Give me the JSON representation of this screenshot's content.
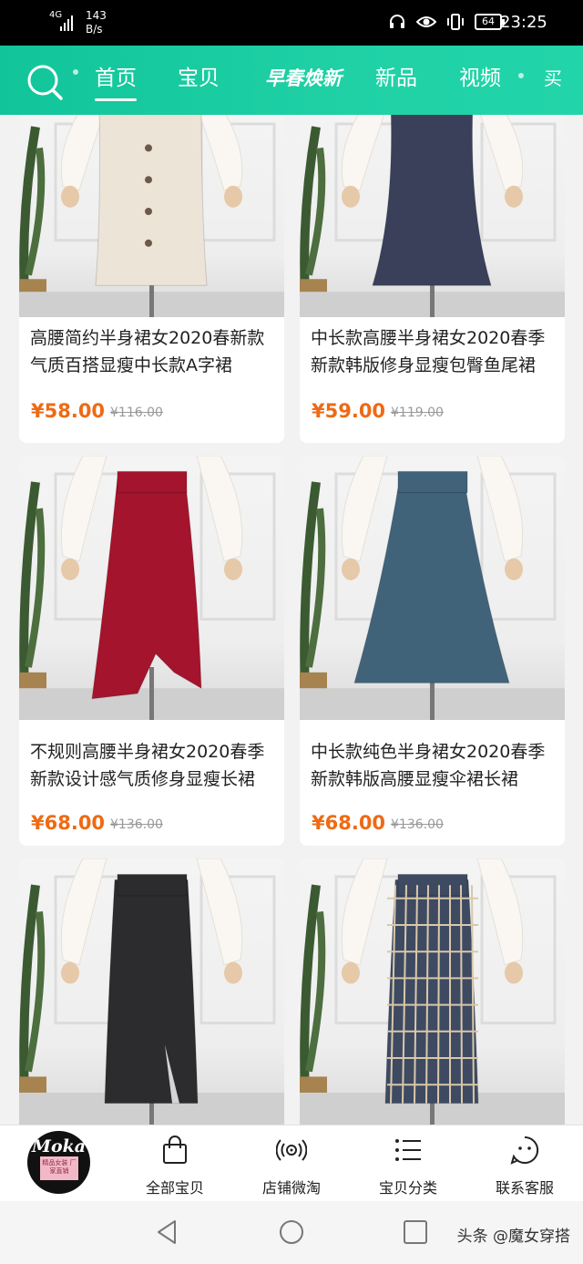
{
  "status_bar": {
    "network": "4G",
    "speed_value": "143",
    "speed_unit": "B/s",
    "battery": "64",
    "time": "23:25",
    "icons": [
      "headphone-icon",
      "eye-icon",
      "vibrate-icon",
      "battery-icon"
    ]
  },
  "nav": {
    "tabs": [
      {
        "label": "首页",
        "active": true
      },
      {
        "label": "宝贝",
        "active": false
      },
      {
        "label": "早春焕新",
        "active": false
      },
      {
        "label": "新品",
        "active": false
      },
      {
        "label": "视频",
        "active": false
      },
      {
        "label": "买",
        "active": false
      }
    ]
  },
  "products": [
    {
      "title": "高腰简约半身裙女2020春新款气质百搭显瘦中长款A字裙",
      "price": "¥58.00",
      "orig_price": "¥116.00",
      "skirt_color": "#ece4d6",
      "style": "button"
    },
    {
      "title": "中长款高腰半身裙女2020春季新款韩版修身显瘦包臀鱼尾裙",
      "price": "¥59.00",
      "orig_price": "¥119.00",
      "skirt_color": "#3a3f5a",
      "style": "mermaid"
    },
    {
      "title": "不规则高腰半身裙女2020春季新款设计感气质修身显瘦长裙",
      "price": "¥68.00",
      "orig_price": "¥136.00",
      "skirt_color": "#a4142c",
      "style": "wrap"
    },
    {
      "title": "中长款纯色半身裙女2020春季新款韩版高腰显瘦伞裙长裙",
      "price": "¥68.00",
      "orig_price": "¥136.00",
      "skirt_color": "#40637a",
      "style": "aline"
    },
    {
      "title": "",
      "price": "",
      "orig_price": "",
      "skirt_color": "#2c2c2e",
      "style": "slit"
    },
    {
      "title": "",
      "price": "",
      "orig_price": "",
      "skirt_color": "#3e4a62",
      "style": "plaid"
    }
  ],
  "shop": {
    "logo_text": "Moka",
    "logo_sub": "精品女装 厂家直销",
    "items": [
      {
        "label": "全部宝贝",
        "icon": "shopping-bag-icon"
      },
      {
        "label": "店铺微淘",
        "icon": "broadcast-icon"
      },
      {
        "label": "宝贝分类",
        "icon": "list-icon"
      },
      {
        "label": "联系客服",
        "icon": "chat-face-icon"
      }
    ]
  },
  "system_nav": {
    "watermark": "头条 @魔女穿搭",
    "icons": [
      "back-triangle-icon",
      "home-circle-icon",
      "recents-square-icon"
    ]
  },
  "colors": {
    "accent": "#1fd1a5",
    "price": "#ee6a14"
  }
}
